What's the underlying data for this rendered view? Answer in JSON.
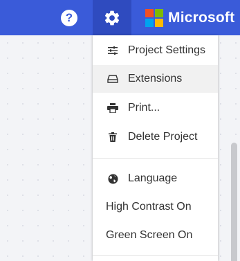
{
  "header": {
    "help_label": "?",
    "brand": "Microsoft",
    "colors": {
      "bar": "#3a5bd9",
      "active": "#2f4bbf",
      "logo": [
        "#f25022",
        "#7fba00",
        "#00a4ef",
        "#ffb900"
      ]
    }
  },
  "settings_menu": {
    "items": [
      {
        "label": "Project Settings",
        "icon": "sliders-icon"
      },
      {
        "label": "Extensions",
        "icon": "drive-icon",
        "state": "hover"
      },
      {
        "label": "Print...",
        "icon": "printer-icon"
      },
      {
        "label": "Delete Project",
        "icon": "trash-icon"
      },
      {
        "label": "Language",
        "icon": "globe-icon"
      },
      {
        "label": "High Contrast On"
      },
      {
        "label": "Green Screen On"
      }
    ]
  }
}
